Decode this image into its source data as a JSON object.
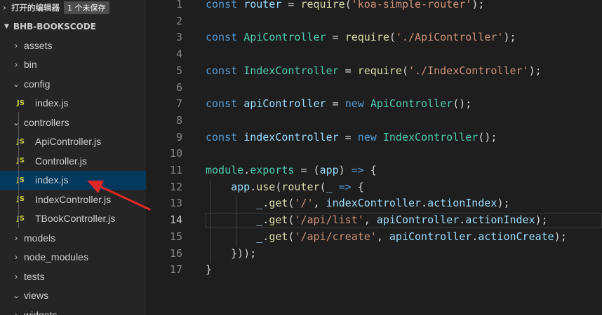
{
  "sidebar": {
    "open_editors_label": "打开的编辑器",
    "unsaved_badge": "1 个未保存",
    "project_name": "BHB-BOOKSCODE",
    "items": [
      {
        "label": "assets",
        "type": "folder",
        "expanded": false,
        "depth": 0
      },
      {
        "label": "bin",
        "type": "folder",
        "expanded": false,
        "depth": 0
      },
      {
        "label": "config",
        "type": "folder",
        "expanded": true,
        "depth": 0
      },
      {
        "label": "index.js",
        "type": "file",
        "depth": 1
      },
      {
        "label": "controllers",
        "type": "folder",
        "expanded": true,
        "depth": 0
      },
      {
        "label": "ApiController.js",
        "type": "file",
        "depth": 1
      },
      {
        "label": "Controller.js",
        "type": "file",
        "depth": 1
      },
      {
        "label": "index.js",
        "type": "file",
        "depth": 1,
        "selected": true
      },
      {
        "label": "IndexController.js",
        "type": "file",
        "depth": 1
      },
      {
        "label": "TBookController.js",
        "type": "file",
        "depth": 1
      },
      {
        "label": "models",
        "type": "folder",
        "expanded": false,
        "depth": 0
      },
      {
        "label": "node_modules",
        "type": "folder",
        "expanded": false,
        "depth": 0
      },
      {
        "label": "tests",
        "type": "folder",
        "expanded": false,
        "depth": 0
      },
      {
        "label": "views",
        "type": "folder",
        "expanded": true,
        "depth": 0
      },
      {
        "label": "widgets",
        "type": "folder",
        "expanded": false,
        "depth": 0
      }
    ],
    "js_icon_text": "JS"
  },
  "editor": {
    "current_line": 14,
    "lines": [
      {
        "n": "1",
        "tokens": [
          [
            "kw",
            "const"
          ],
          [
            "pl",
            " "
          ],
          [
            "var",
            "router"
          ],
          [
            "pl",
            " = "
          ],
          [
            "fn",
            "require"
          ],
          [
            "pl",
            "("
          ],
          [
            "str",
            "'koa-simple-router'"
          ],
          [
            "pl",
            ");"
          ]
        ]
      },
      {
        "n": "2",
        "tokens": []
      },
      {
        "n": "3",
        "tokens": [
          [
            "kw",
            "const"
          ],
          [
            "pl",
            " "
          ],
          [
            "ty",
            "ApiController"
          ],
          [
            "pl",
            " = "
          ],
          [
            "fn",
            "require"
          ],
          [
            "pl",
            "("
          ],
          [
            "str",
            "'./ApiController'"
          ],
          [
            "pl",
            ");"
          ]
        ]
      },
      {
        "n": "4",
        "tokens": []
      },
      {
        "n": "5",
        "tokens": [
          [
            "kw",
            "const"
          ],
          [
            "pl",
            " "
          ],
          [
            "ty",
            "IndexController"
          ],
          [
            "pl",
            " = "
          ],
          [
            "fn",
            "require"
          ],
          [
            "pl",
            "("
          ],
          [
            "str",
            "'./IndexController'"
          ],
          [
            "pl",
            ");"
          ]
        ]
      },
      {
        "n": "6",
        "tokens": []
      },
      {
        "n": "7",
        "tokens": [
          [
            "kw",
            "const"
          ],
          [
            "pl",
            " "
          ],
          [
            "var",
            "apiController"
          ],
          [
            "pl",
            " = "
          ],
          [
            "kw",
            "new"
          ],
          [
            "pl",
            " "
          ],
          [
            "ty",
            "ApiController"
          ],
          [
            "pl",
            "();"
          ]
        ]
      },
      {
        "n": "8",
        "tokens": []
      },
      {
        "n": "9",
        "tokens": [
          [
            "kw",
            "const"
          ],
          [
            "pl",
            " "
          ],
          [
            "var",
            "indexController"
          ],
          [
            "pl",
            " = "
          ],
          [
            "kw",
            "new"
          ],
          [
            "pl",
            " "
          ],
          [
            "ty",
            "IndexController"
          ],
          [
            "pl",
            "();"
          ]
        ]
      },
      {
        "n": "10",
        "tokens": []
      },
      {
        "n": "11",
        "tokens": [
          [
            "ty",
            "module"
          ],
          [
            "pl",
            "."
          ],
          [
            "ty",
            "exports"
          ],
          [
            "pl",
            " = ("
          ],
          [
            "var",
            "app"
          ],
          [
            "pl",
            ") "
          ],
          [
            "kw",
            "=>"
          ],
          [
            "pl",
            " {"
          ]
        ]
      },
      {
        "n": "12",
        "tokens": [
          [
            "pl",
            "    "
          ],
          [
            "var",
            "app"
          ],
          [
            "pl",
            "."
          ],
          [
            "fn",
            "use"
          ],
          [
            "pl",
            "("
          ],
          [
            "fn",
            "router"
          ],
          [
            "pl",
            "("
          ],
          [
            "var",
            "_"
          ],
          [
            "pl",
            " "
          ],
          [
            "kw",
            "=>"
          ],
          [
            "pl",
            " {"
          ]
        ]
      },
      {
        "n": "13",
        "tokens": [
          [
            "pl",
            "        "
          ],
          [
            "var",
            "_"
          ],
          [
            "pl",
            "."
          ],
          [
            "fn",
            "get"
          ],
          [
            "pl",
            "("
          ],
          [
            "str",
            "'/'"
          ],
          [
            "pl",
            ", "
          ],
          [
            "var",
            "indexController"
          ],
          [
            "pl",
            "."
          ],
          [
            "var",
            "actionIndex"
          ],
          [
            "pl",
            ");"
          ]
        ]
      },
      {
        "n": "14",
        "tokens": [
          [
            "pl",
            "        "
          ],
          [
            "var",
            "_"
          ],
          [
            "pl",
            "."
          ],
          [
            "fn",
            "get"
          ],
          [
            "pl",
            "("
          ],
          [
            "str",
            "'/api/list'"
          ],
          [
            "pl",
            ", "
          ],
          [
            "var",
            "apiController"
          ],
          [
            "pl",
            "."
          ],
          [
            "var",
            "actionIndex"
          ],
          [
            "pl",
            ");"
          ]
        ]
      },
      {
        "n": "15",
        "tokens": [
          [
            "pl",
            "        "
          ],
          [
            "var",
            "_"
          ],
          [
            "pl",
            "."
          ],
          [
            "fn",
            "get"
          ],
          [
            "pl",
            "("
          ],
          [
            "str",
            "'/api/create'"
          ],
          [
            "pl",
            ", "
          ],
          [
            "var",
            "apiController"
          ],
          [
            "pl",
            "."
          ],
          [
            "var",
            "actionCreate"
          ],
          [
            "pl",
            ");"
          ]
        ]
      },
      {
        "n": "16",
        "tokens": [
          [
            "pl",
            "    "
          ],
          [
            "pl",
            "}));"
          ]
        ]
      },
      {
        "n": "17",
        "tokens": [
          [
            "pl",
            "}"
          ]
        ]
      }
    ]
  },
  "colors": {
    "annotation_arrow": "#e02828",
    "selection": "#04395e"
  }
}
